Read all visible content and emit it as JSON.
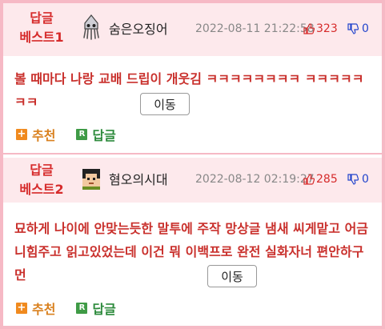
{
  "comments": [
    {
      "badge_line1": "답글",
      "badge_line2": "베스트1",
      "nickname": "숨은오징어",
      "avatar_icon": "squid-icon",
      "date": "2022-08-11 21:22:58",
      "likes": "323",
      "dislikes": "0",
      "text": "볼 때마다 나랑 교배 드립이 개웃김 ㅋㅋㅋㅋㅋㅋㅋㅋ ㅋㅋㅋㅋㅋㅋㅋ",
      "move_label": "이동",
      "recommend_label": "추천",
      "reply_label": "답글"
    },
    {
      "badge_line1": "답글",
      "badge_line2": "베스트2",
      "nickname": "혐오의시대",
      "avatar_icon": "pixel-face-icon",
      "date": "2022-08-12 02:19:27",
      "likes": "285",
      "dislikes": "0",
      "text": "묘하게 나이에 안맞는듯한 말투에 주작 망상글 냄새 씨게맡고 어금니힘주고 읽고있었는데 이건 뭐 이백프로 완전 실화자너 편안하구먼",
      "move_label": "이동",
      "recommend_label": "추천",
      "reply_label": "답글"
    }
  ],
  "colors": {
    "border": "#f6b9c5",
    "header_bg": "#fde9ec",
    "best_red": "#d62b2b",
    "body_red": "#c9302c",
    "recommend_orange": "#d9801e",
    "reply_green": "#2c8a3b",
    "dislike_blue": "#2244cc"
  },
  "icons": {
    "recommend": "plus-icon",
    "reply": "reply-r-icon",
    "like": "thumbs-up-icon",
    "dislike": "thumbs-down-icon"
  }
}
